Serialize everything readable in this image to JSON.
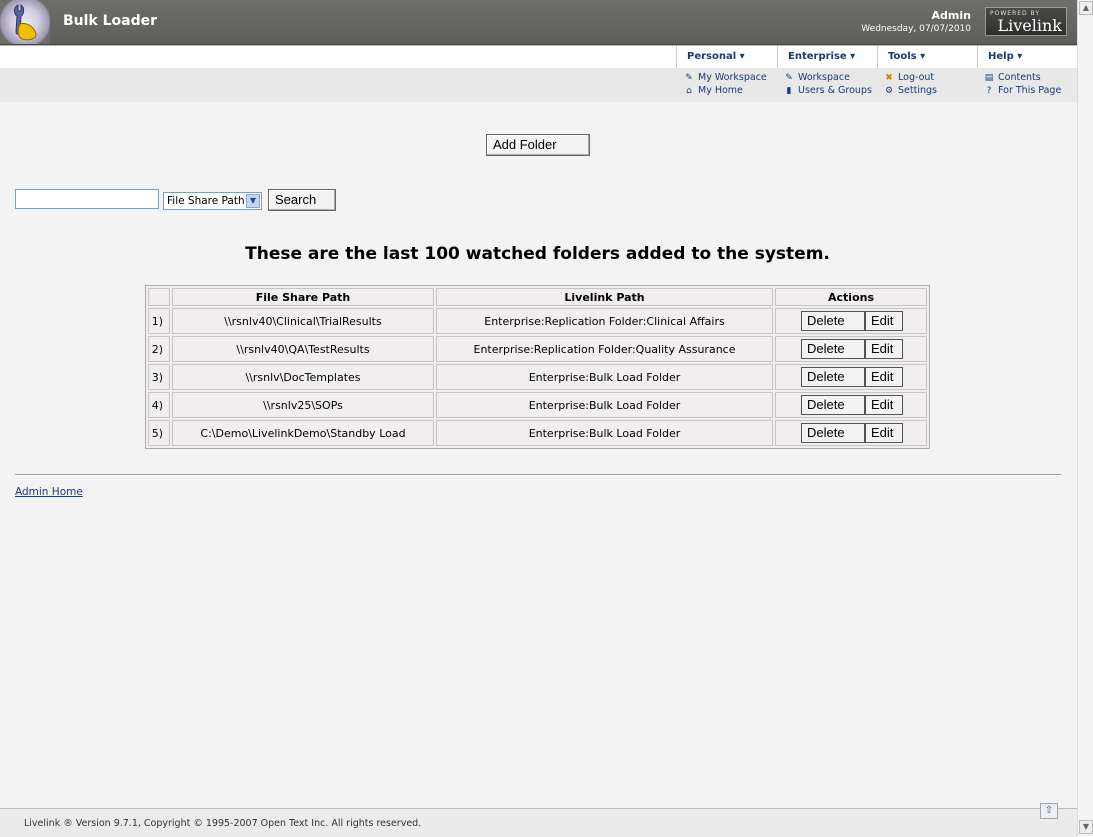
{
  "header": {
    "app_title": "Bulk Loader",
    "user_name": "Admin",
    "date": "Wednesday, 07/07/2010",
    "powered_by": "POWERED BY",
    "brand": "Livelink"
  },
  "menu": {
    "items": [
      {
        "label": "Personal ▾"
      },
      {
        "label": "Enterprise ▾"
      },
      {
        "label": "Tools ▾"
      },
      {
        "label": "Help ▾"
      }
    ],
    "sub": {
      "personal": [
        "My Workspace",
        "My Home"
      ],
      "enterprise": [
        "Workspace",
        "Users & Groups"
      ],
      "tools": [
        "Log-out",
        "Settings"
      ],
      "help": [
        "Contents",
        "For This Page"
      ]
    }
  },
  "actions": {
    "add_folder": "Add Folder",
    "search_button": "Search",
    "search_value": "",
    "search_field": "File Share Path"
  },
  "heading": "These are the last 100 watched folders added to the system.",
  "table": {
    "headers": [
      "",
      "File Share Path",
      "Livelink Path",
      "Actions"
    ],
    "rows": [
      {
        "num": "1)",
        "share": "\\\\rsnlv40\\Clinical\\TrialResults",
        "path": "Enterprise:Replication Folder:Clinical Affairs"
      },
      {
        "num": "2)",
        "share": "\\\\rsnlv40\\QA\\TestResults",
        "path": "Enterprise:Replication Folder:Quality Assurance"
      },
      {
        "num": "3)",
        "share": "\\\\rsnlv\\DocTemplates",
        "path": "Enterprise:Bulk Load Folder"
      },
      {
        "num": "4)",
        "share": "\\\\rsnlv25\\SOPs",
        "path": "Enterprise:Bulk Load Folder"
      },
      {
        "num": "5)",
        "share": "C:\\Demo\\LivelinkDemo\\Standby Load",
        "path": "Enterprise:Bulk Load Folder"
      }
    ],
    "delete_label": "Delete",
    "edit_label": "Edit"
  },
  "links": {
    "admin_home": "Admin Home"
  },
  "footer": {
    "text": "Livelink ® Version 9.7.1, Copyright © 1995-2007 Open Text Inc. All rights reserved."
  }
}
